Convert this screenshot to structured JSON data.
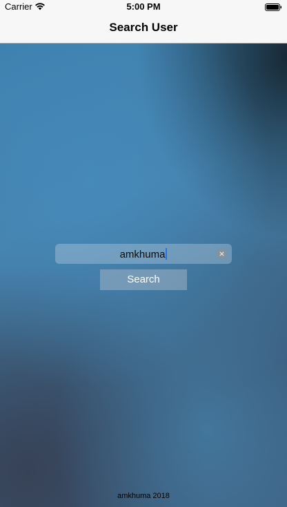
{
  "status_bar": {
    "carrier": "Carrier",
    "time": "5:00 PM"
  },
  "nav": {
    "title": "Search User"
  },
  "search": {
    "value": "amkhuma",
    "button_label": "Search"
  },
  "footer": {
    "text": "amkhuma 2018"
  },
  "icons": {
    "wifi": "wifi-icon",
    "battery": "battery-icon",
    "clear": "clear-icon"
  },
  "colors": {
    "bar_background": "#f7f7f7",
    "caret": "#2f6fe0",
    "button_text": "#ffffff"
  }
}
